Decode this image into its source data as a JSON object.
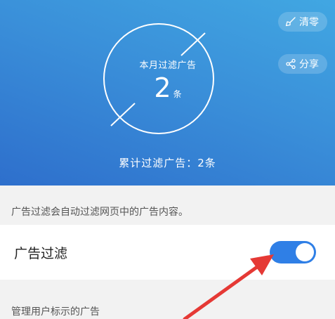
{
  "header": {
    "month_label": "本月过滤广告",
    "month_count": "2",
    "count_unit": "条",
    "total_line": "累计过滤广告：2条",
    "clear_label": "清零",
    "share_label": "分享",
    "colors": {
      "gradient_start": "#41a7e2",
      "gradient_end": "#2e6fcc",
      "ring": "#ffffff"
    }
  },
  "description": {
    "text": "广告过滤会自动过滤网页中的广告内容。"
  },
  "ad_filter_row": {
    "label": "广告过滤",
    "toggle_on": true,
    "toggle_color": "#2f7fe6"
  },
  "section": {
    "title": "管理用户标示的广告"
  },
  "annotation": {
    "arrow_color": "#e53935"
  },
  "icons": {
    "clear": "broom-icon",
    "share": "share-icon"
  }
}
